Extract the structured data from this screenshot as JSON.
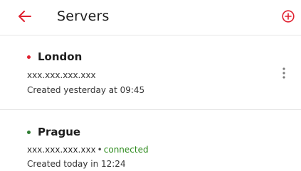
{
  "appbar": {
    "title": "Servers",
    "back_icon": "arrow-left-icon",
    "add_icon": "plus-circle-icon",
    "accent": "#e0202f"
  },
  "servers": [
    {
      "name": "London",
      "status_color": "#e0202f",
      "address": "xxx.xxx.xxx.xxx",
      "created": "Created yesterday at 09:45",
      "menu_icon": "more-vertical-icon"
    },
    {
      "name": "Prague",
      "status_color": "#2e7d32",
      "address": "xxx.xxx.xxx.xxx",
      "separator": "•",
      "status": "connected",
      "status_text_color": "#2e8b1e",
      "created": "Created today in 12:24"
    }
  ]
}
